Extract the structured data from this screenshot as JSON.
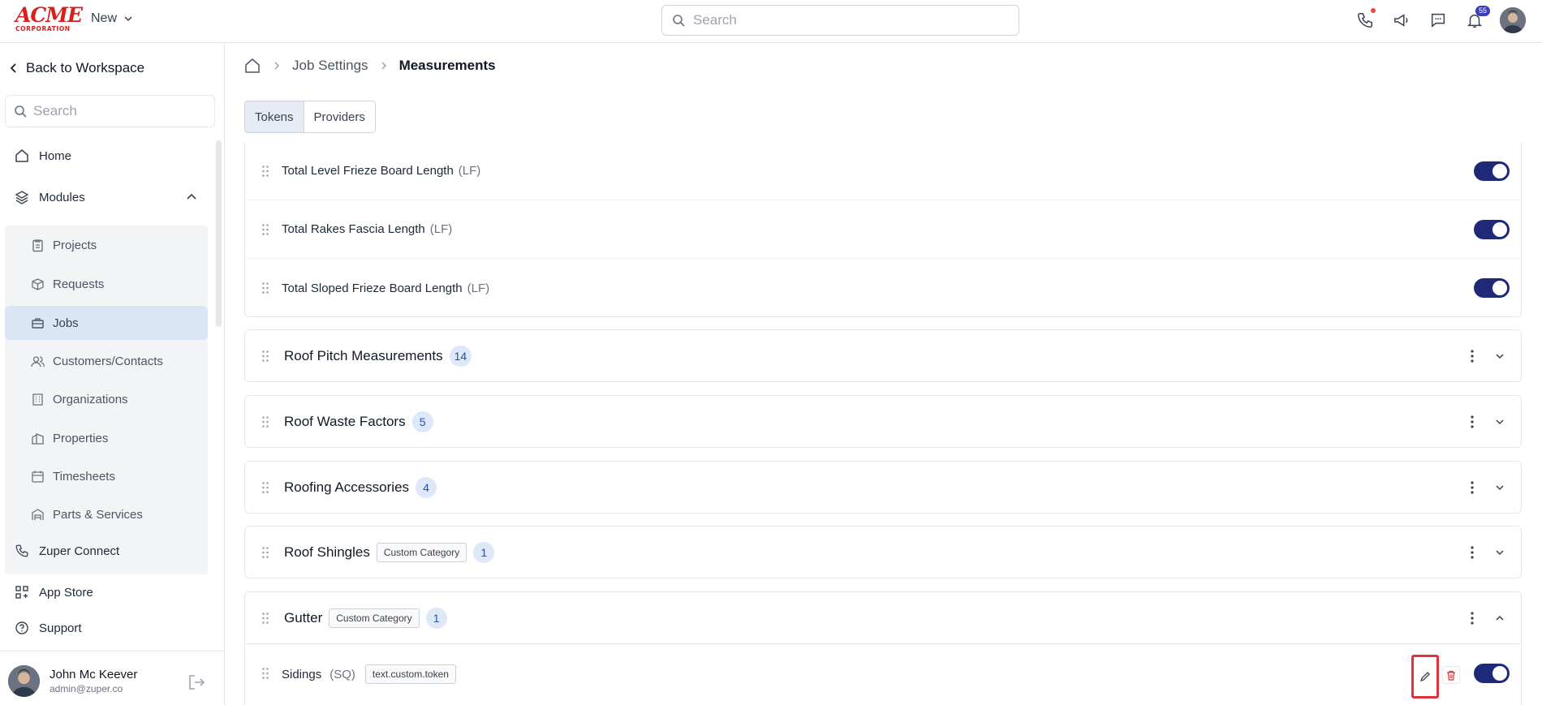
{
  "header": {
    "logo_main": "ACME",
    "logo_sub": "CORPORATION",
    "new_label": "New",
    "search_placeholder": "Search",
    "notifications_count": "55"
  },
  "sidebar": {
    "back_label": "Back to Workspace",
    "search_placeholder": "Search",
    "home_label": "Home",
    "modules_label": "Modules",
    "modules": [
      {
        "label": "Projects",
        "icon": "clipboard-icon"
      },
      {
        "label": "Requests",
        "icon": "box-icon"
      },
      {
        "label": "Jobs",
        "icon": "briefcase-icon",
        "active": true
      },
      {
        "label": "Customers/Contacts",
        "icon": "users-icon"
      },
      {
        "label": "Organizations",
        "icon": "building-icon"
      },
      {
        "label": "Properties",
        "icon": "buildings-icon"
      },
      {
        "label": "Timesheets",
        "icon": "calendar-icon"
      },
      {
        "label": "Parts & Services",
        "icon": "warehouse-icon"
      }
    ],
    "zuper_connect_label": "Zuper Connect",
    "app_store_label": "App Store",
    "support_label": "Support",
    "user": {
      "name": "John Mc Keever",
      "email": "admin@zuper.co"
    }
  },
  "breadcrumb": {
    "level1": "Job Settings",
    "level2": "Measurements"
  },
  "tabs": [
    "Tokens",
    "Providers"
  ],
  "active_tab": "Tokens",
  "tokens_top": [
    {
      "name": "Total Level Frieze Board Length",
      "unit": "(LF)"
    },
    {
      "name": "Total Rakes Fascia Length",
      "unit": "(LF)"
    },
    {
      "name": "Total Sloped Frieze Board Length",
      "unit": "(LF)"
    }
  ],
  "categories": [
    {
      "name": "Roof Pitch Measurements",
      "count": "14"
    },
    {
      "name": "Roof Waste Factors",
      "count": "5"
    },
    {
      "name": "Roofing Accessories",
      "count": "4"
    },
    {
      "name": "Roof Shingles",
      "tag": "Custom Category",
      "count": "1"
    }
  ],
  "gutter": {
    "name": "Gutter",
    "tag": "Custom Category",
    "count": "1",
    "token": {
      "name": "Sidings",
      "unit": "(SQ)",
      "key": "text.custom.token"
    }
  },
  "colors": {
    "toggle_on": "#1e2a78",
    "badge_bg": "#dde8f8",
    "highlight": "#e0323a"
  }
}
